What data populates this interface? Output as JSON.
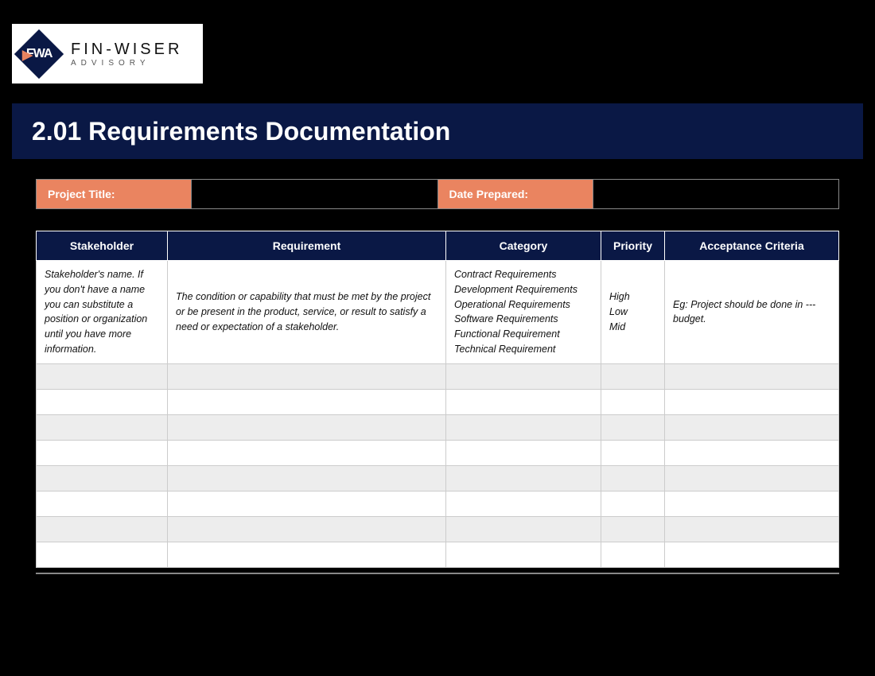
{
  "logo": {
    "initials": "FWA",
    "main": "FIN-WISER",
    "sub": "ADVISORY"
  },
  "title": "2.01 Requirements Documentation",
  "meta": {
    "project_title_label": "Project Title:",
    "project_title_value": "",
    "date_prepared_label": "Date Prepared:",
    "date_prepared_value": ""
  },
  "columns": {
    "stakeholder": "Stakeholder",
    "requirement": "Requirement",
    "category": "Category",
    "priority": "Priority",
    "acceptance": "Acceptance Criteria"
  },
  "info": {
    "stakeholder": "Stakeholder's name. If you don't have a name you can substitute a position or organization until you have more information.",
    "requirement": "The condition or capability that must be met by the project or be present in the product, service, or result to satisfy a need or expectation of a stakeholder.",
    "categories": [
      "Contract Requirements",
      "Development Requirements",
      "Operational Requirements",
      "Software Requirements",
      "Functional Requirement",
      "Technical Requirement"
    ],
    "priorities": [
      "High",
      "Low",
      "Mid"
    ],
    "acceptance": "Eg: Project should be done in --- budget."
  }
}
